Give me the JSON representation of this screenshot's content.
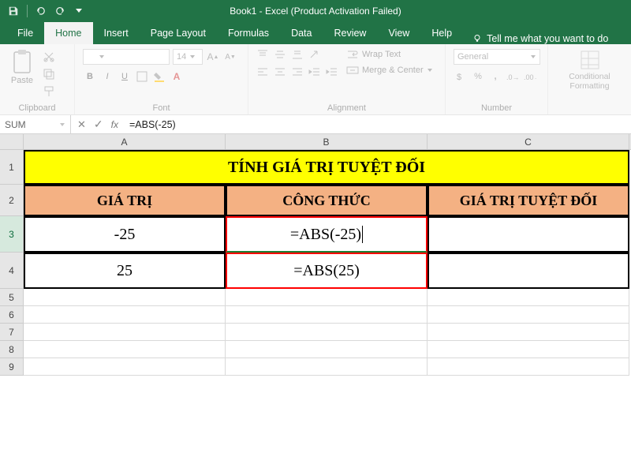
{
  "app": {
    "title": "Book1  -  Excel (Product Activation Failed)"
  },
  "qat": {
    "save": "save-icon",
    "undo": "undo-icon",
    "redo": "redo-icon"
  },
  "tabs": {
    "file": "File",
    "home": "Home",
    "insert": "Insert",
    "page_layout": "Page Layout",
    "formulas": "Formulas",
    "data": "Data",
    "review": "Review",
    "view": "View",
    "help": "Help",
    "tell_me": "Tell me what you want to do"
  },
  "ribbon": {
    "clipboard": {
      "paste": "Paste",
      "label": "Clipboard"
    },
    "font": {
      "label": "Font",
      "font_size": "14",
      "b": "B",
      "i": "I",
      "u": "U"
    },
    "alignment": {
      "label": "Alignment",
      "wrap": "Wrap Text",
      "merge": "Merge & Center"
    },
    "number": {
      "label": "Number",
      "format": "General"
    },
    "styles": {
      "conditional": "Conditional Formatting"
    }
  },
  "formula_bar": {
    "name_box": "SUM",
    "formula": "=ABS(-25)"
  },
  "columns": {
    "A": "A",
    "B": "B",
    "C": "C"
  },
  "rows": [
    "1",
    "2",
    "3",
    "4",
    "5",
    "6",
    "7",
    "8",
    "9"
  ],
  "sheet": {
    "title": "TÍNH GIÁ TRỊ TUYỆT ĐỐI",
    "headers": {
      "a": "GIÁ TRỊ",
      "b": "CÔNG THỨC",
      "c": "GIÁ TRỊ TUYỆT ĐỐI"
    },
    "rows": [
      {
        "a": "-25",
        "b": "=ABS(-25)",
        "c": ""
      },
      {
        "a": "25",
        "b": "=ABS(25)",
        "c": ""
      }
    ]
  },
  "chart_data": {
    "type": "table",
    "title": "TÍNH GIÁ TRỊ TUYỆT ĐỐI",
    "columns": [
      "GIÁ TRỊ",
      "CÔNG THỨC",
      "GIÁ TRỊ TUYỆT ĐỐI"
    ],
    "rows": [
      [
        "-25",
        "=ABS(-25)",
        ""
      ],
      [
        "25",
        "=ABS(25)",
        ""
      ]
    ]
  }
}
